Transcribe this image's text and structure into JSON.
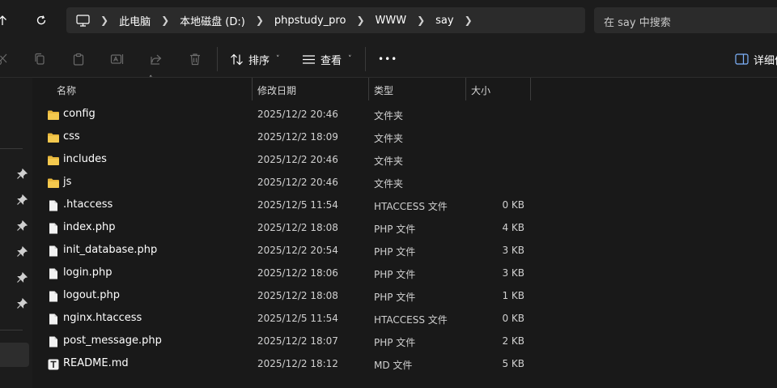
{
  "breadcrumb": [
    "此电脑",
    "本地磁盘 (D:)",
    "phpstudy_pro",
    "WWW",
    "say"
  ],
  "search": {
    "placeholder": "在 say 中搜索"
  },
  "toolbar": {
    "sort_label": "排序",
    "view_label": "查看",
    "more_label": "•••",
    "details_label": "详细信"
  },
  "columns": {
    "name": "名称",
    "date": "修改日期",
    "type": "类型",
    "size": "大小"
  },
  "colors": {
    "background": "#191919",
    "folder": "#e8b73c",
    "text": "#ffffff",
    "muted": "#d0d0d0"
  },
  "files": [
    {
      "icon": "folder-icon",
      "name": "config",
      "date": "2025/12/2 20:46",
      "type": "文件夹",
      "size": ""
    },
    {
      "icon": "folder-icon",
      "name": "css",
      "date": "2025/12/2 18:09",
      "type": "文件夹",
      "size": ""
    },
    {
      "icon": "folder-icon",
      "name": "includes",
      "date": "2025/12/2 20:46",
      "type": "文件夹",
      "size": ""
    },
    {
      "icon": "folder-icon",
      "name": "js",
      "date": "2025/12/2 20:46",
      "type": "文件夹",
      "size": ""
    },
    {
      "icon": "file-icon",
      "name": ".htaccess",
      "date": "2025/12/5 11:54",
      "type": "HTACCESS 文件",
      "size": "0 KB"
    },
    {
      "icon": "file-icon",
      "name": "index.php",
      "date": "2025/12/2 18:08",
      "type": "PHP 文件",
      "size": "4 KB"
    },
    {
      "icon": "file-icon",
      "name": "init_database.php",
      "date": "2025/12/2 20:54",
      "type": "PHP 文件",
      "size": "3 KB"
    },
    {
      "icon": "file-icon",
      "name": "login.php",
      "date": "2025/12/2 18:06",
      "type": "PHP 文件",
      "size": "3 KB"
    },
    {
      "icon": "file-icon",
      "name": "logout.php",
      "date": "2025/12/2 18:08",
      "type": "PHP 文件",
      "size": "1 KB"
    },
    {
      "icon": "file-icon",
      "name": "nginx.htaccess",
      "date": "2025/12/5 11:54",
      "type": "HTACCESS 文件",
      "size": "0 KB"
    },
    {
      "icon": "file-icon",
      "name": "post_message.php",
      "date": "2025/12/2 18:07",
      "type": "PHP 文件",
      "size": "2 KB"
    },
    {
      "icon": "text-file-icon",
      "name": "README.md",
      "date": "2025/12/2 18:12",
      "type": "MD 文件",
      "size": "5 KB"
    }
  ]
}
